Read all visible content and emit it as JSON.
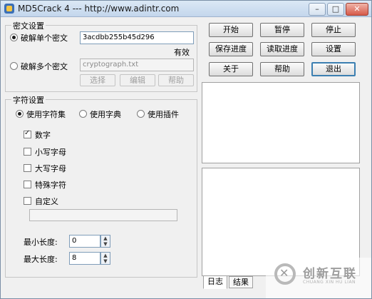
{
  "window": {
    "title": "MD5Crack 4  ---  http://www.adintr.com",
    "min": "–",
    "max": "□",
    "close": "✕"
  },
  "cipher_group": {
    "legend": "密文设置",
    "single_label": "破解单个密文",
    "single_value": "3acdbb255b45d296",
    "valid_text": "有效",
    "multi_label": "破解多个密文",
    "multi_placeholder": "cryptograph.txt",
    "select_button": "选择",
    "edit_button": "编辑",
    "help_button": "帮助"
  },
  "charset_group": {
    "legend": "字符设置",
    "mode_charset": "使用字符集",
    "mode_dictionary": "使用字典",
    "mode_plugin": "使用插件",
    "options": [
      {
        "label": "数字",
        "checked": true
      },
      {
        "label": "小写字母",
        "checked": false
      },
      {
        "label": "大写字母",
        "checked": false
      },
      {
        "label": "特殊字符",
        "checked": false
      },
      {
        "label": "自定义",
        "checked": false
      }
    ],
    "custom_value": "",
    "min_length_label": "最小长度:",
    "min_length": "0",
    "max_length_label": "最大长度:",
    "max_length": "8"
  },
  "actions": {
    "start": "开始",
    "pause": "暂停",
    "stop": "停止",
    "save_progress": "保存进度",
    "load_progress": "读取进度",
    "settings": "设置",
    "about": "关于",
    "help": "帮助",
    "exit": "退出"
  },
  "tabs": {
    "log": "日志",
    "results": "结果"
  },
  "watermark": {
    "brand": "创新互联",
    "sub": "CHUANG XIN HU LIAN"
  }
}
